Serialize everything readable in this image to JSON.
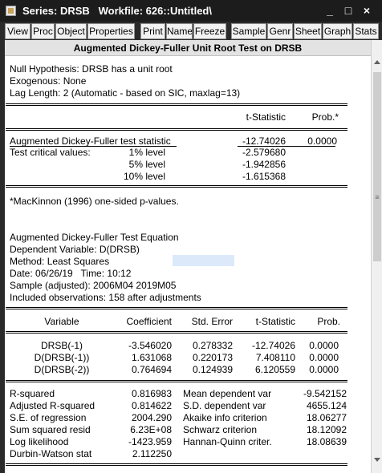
{
  "window": {
    "title": "Series: DRSB   Workfile: 626::Untitled\\",
    "controls": {
      "minimize": "_",
      "maximize": "□",
      "close": "×"
    }
  },
  "toolbar": {
    "buttons": [
      "View",
      "Proc",
      "Object",
      "Properties",
      "Print",
      "Name",
      "Freeze",
      "Sample",
      "Genr",
      "Sheet",
      "Graph",
      "Stats"
    ]
  },
  "header": {
    "title": "Augmented Dickey-Fuller Unit Root Test on DRSB"
  },
  "info": {
    "null_hypothesis": "Null Hypothesis: DRSB has a unit root",
    "exogenous": "Exogenous: None",
    "lag_length": "Lag Length: 2 (Automatic - based on SIC, maxlag=13)"
  },
  "adf_table": {
    "col_tstat": "t-Statistic",
    "col_prob": "Prob.*",
    "adf_label": "Augmented Dickey-Fuller test statistic",
    "adf_tstat": "-12.74026",
    "adf_prob": "0.0000",
    "crit_label": "Test critical values:",
    "crit": [
      {
        "level": "1% level",
        "value": "-2.579680"
      },
      {
        "level": "5% level",
        "value": "-1.942856"
      },
      {
        "level": "10% level",
        "value": "-1.615368"
      }
    ],
    "footnote": "*MacKinnon (1996) one-sided p-values."
  },
  "equation": {
    "title": "Augmented Dickey-Fuller Test Equation",
    "dependent": "Dependent Variable: D(DRSB)",
    "method": "Method: Least Squares",
    "date": "Date: 06/26/19   Time: 10:12",
    "sample": "Sample (adjusted): 2006M04 2019M05",
    "observations": "Included observations: 158 after adjustments"
  },
  "coef_table": {
    "headers": {
      "variable": "Variable",
      "coefficient": "Coefficient",
      "std_error": "Std. Error",
      "tstat": "t-Statistic",
      "prob": "Prob."
    },
    "rows": [
      {
        "variable": "DRSB(-1)",
        "coefficient": "-3.546020",
        "std_error": "0.278332",
        "tstat": "-12.74026",
        "prob": "0.0000"
      },
      {
        "variable": "D(DRSB(-1))",
        "coefficient": "1.631068",
        "std_error": "0.220173",
        "tstat": "7.408110",
        "prob": "0.0000"
      },
      {
        "variable": "D(DRSB(-2))",
        "coefficient": "0.764694",
        "std_error": "0.124939",
        "tstat": "6.120559",
        "prob": "0.0000"
      }
    ]
  },
  "stats": {
    "left": [
      {
        "label": "R-squared",
        "value": "0.816983"
      },
      {
        "label": "Adjusted R-squared",
        "value": "0.814622"
      },
      {
        "label": "S.E. of regression",
        "value": "2004.290"
      },
      {
        "label": "Sum squared resid",
        "value": "6.23E+08"
      },
      {
        "label": "Log likelihood",
        "value": "-1423.959"
      },
      {
        "label": "Durbin-Watson stat",
        "value": "2.112250"
      }
    ],
    "right": [
      {
        "label": "Mean dependent var",
        "value": "-9.542152"
      },
      {
        "label": "S.D. dependent var",
        "value": "4655.124"
      },
      {
        "label": "Akaike info criterion",
        "value": "18.06277"
      },
      {
        "label": "Schwarz criterion",
        "value": "18.12092"
      },
      {
        "label": "Hannan-Quinn criter.",
        "value": "18.08639"
      }
    ]
  }
}
